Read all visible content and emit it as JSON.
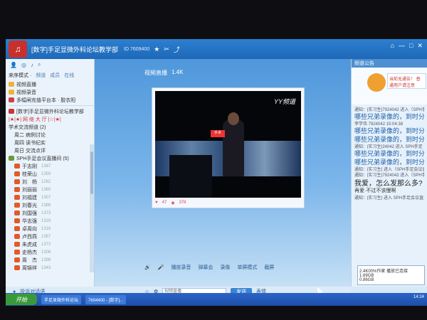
{
  "window": {
    "title": "[数字]手足显微外科论坛教学部",
    "room_id": "ID 7609400",
    "icons": [
      "star-icon",
      "scissors-icon",
      "share-icon"
    ],
    "controls": [
      "home-icon",
      "minimize-icon",
      "maximize-icon",
      "close-icon"
    ]
  },
  "left": {
    "toolbar_icons": [
      "user-icon",
      "location-icon",
      "music-icon",
      "search-icon"
    ],
    "mode_label": "来序模式 ·",
    "mode_tabs": [
      "频道",
      "成员",
      "在线"
    ],
    "top_items": [
      {
        "label": "视频直播",
        "icon_color": "#f2b23a"
      },
      {
        "label": "视频录音",
        "icon_color": "#f2b23a"
      },
      {
        "label": "多幅闸充值平台本 · 胶衣阳",
        "icon_color": "#d04040"
      }
    ],
    "channel_items": [
      "[数字]手足显微外科论坛教学部",
      "|★|★|  网 络 大 厅  |☆|★|",
      "学术交流频道 (2)",
      "周二  病例讨论",
      "周四  读书纪实",
      "周日  交流点评",
      "SPH手足会议直播间 (5)"
    ],
    "members": [
      {
        "name": "于志刚",
        "num": "1367"
      },
      {
        "name": "桂荣山",
        "num": "1359"
      },
      {
        "name": "刘　杨",
        "num": "1282"
      },
      {
        "name": "刘丽丽",
        "num": "1380"
      },
      {
        "name": "刘福建",
        "num": "1307"
      },
      {
        "name": "刘春光",
        "num": "1386"
      },
      {
        "name": "刘国强",
        "num": "1373"
      },
      {
        "name": "华志强",
        "num": "1329"
      },
      {
        "name": "卓周向",
        "num": "1316"
      },
      {
        "name": "卢西燕",
        "num": "1367"
      },
      {
        "name": "朱虎成",
        "num": "1372"
      },
      {
        "name": "史杨杰",
        "num": "1306"
      },
      {
        "name": "周　杰",
        "num": "1396"
      },
      {
        "name": "周锦祥",
        "num": "1343"
      }
    ],
    "bottom_items": [
      "投诉对话语",
      "播放录音",
      "录音"
    ]
  },
  "center": {
    "video_title": "视频直播",
    "video_count": "1.4K",
    "watermark": "YY频道",
    "podium_sign": "手术",
    "likes": "47",
    "views": "378",
    "controls": [
      "播放录音",
      "弹幕会",
      "录像",
      "单屏模式",
      "截屏"
    ]
  },
  "input_row": {
    "placeholder": "视频直播",
    "send_label": "发送",
    "extra": "表情"
  },
  "right": {
    "header": "频道公告",
    "bubble_text": "当前无通告！ 普通用户请注意",
    "messages": [
      {
        "type": "sys",
        "text": "通知：[实习生]7924042 进入（SPH手足显微外科）"
      },
      {
        "type": "big",
        "text": "哪些兄弟录像的，到时分享"
      },
      {
        "type": "sys",
        "text": "李学伟 7924042 15:04:38"
      },
      {
        "type": "big",
        "text": "哪些兄弟录像的，到时分享"
      },
      {
        "type": "big",
        "text": "哪些兄弟录像的，到时分享"
      },
      {
        "type": "sys",
        "text": "通知：[实习生]24042 进入 SPH手足"
      },
      {
        "type": "big",
        "text": "哪些兄弟录像的，到时分享"
      },
      {
        "type": "big",
        "text": "哪些兄弟录像的，到时分享"
      },
      {
        "type": "sys",
        "text": "通知：[实习生] 进入（SPH手足会议直播间）"
      },
      {
        "type": "sys",
        "text": "通知：[实习生]7924042 进入（SPH手足显微外科）"
      },
      {
        "type": "me",
        "text": "我爱，怎么发那么多?"
      },
      {
        "type": "small",
        "text": "再爱·不过不该慢啊"
      },
      {
        "type": "sys",
        "text": "通知：[实习生] 进入 SPH手足会议直播间"
      }
    ],
    "popup_title": "2.4K00%作家  播放已连接",
    "popup_line1": "1.69GB",
    "popup_line2": "0.86GB"
  },
  "taskbar": {
    "start": "开始",
    "tasks": [
      "手足显微外科论坛",
      "7604400 - [数字]..."
    ],
    "tray": "14:24"
  }
}
